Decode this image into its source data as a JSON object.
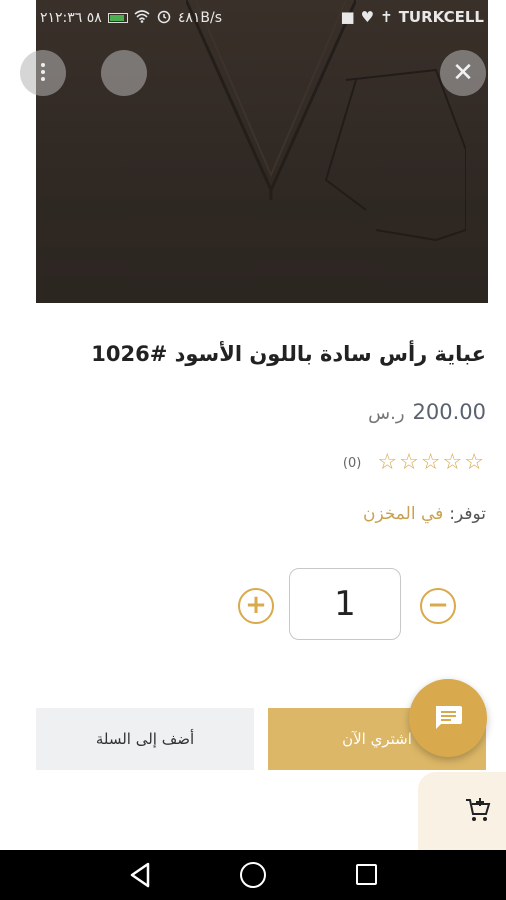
{
  "status_bar": {
    "left_text": "٥٨ ٢١٢:٣٦",
    "speed": "٤٨١B/s",
    "carrier": "TURKCELL"
  },
  "product": {
    "title": "عباية رأس سادة باللون الأسود #1026",
    "price": "200.00",
    "currency": "ر.س",
    "rating_count": "(0)",
    "stars": 5,
    "availability_label": "توفر:",
    "availability_value": "في المخزن"
  },
  "quantity": {
    "value": "1",
    "plus_icon": "plus-circle-icon",
    "minus_icon": "minus-circle-icon"
  },
  "actions": {
    "buy_now": "اشتري الآن",
    "add_to_cart": "أضف إلى السلة"
  },
  "colors": {
    "accent": "#d9a94b",
    "buy_bg": "#dcb767",
    "cart_bg": "#eef0f2"
  }
}
